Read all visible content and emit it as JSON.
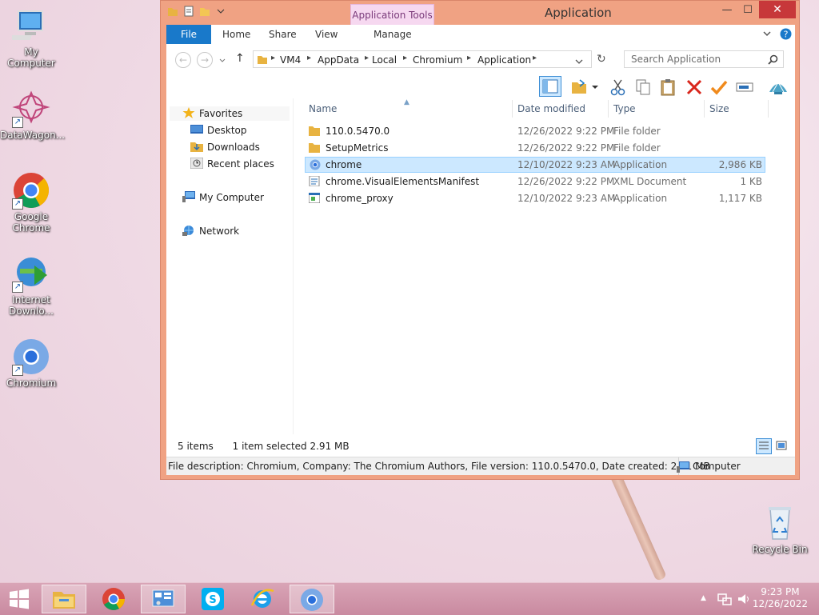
{
  "desktop": {
    "icons": [
      {
        "label": "My Computer"
      },
      {
        "label": "DataWagon..."
      },
      {
        "label": "Google Chrome"
      },
      {
        "label": "Internet Downlo..."
      },
      {
        "label": "Chromium"
      },
      {
        "label": "Recycle Bin"
      }
    ]
  },
  "window": {
    "title": "Application",
    "contextual_tab": "Application Tools",
    "controls": {
      "minimize": "—",
      "maximize": "☐",
      "close": "✕"
    },
    "ribbon": {
      "tabs": [
        {
          "label": "File"
        },
        {
          "label": "Home"
        },
        {
          "label": "Share"
        },
        {
          "label": "View"
        },
        {
          "label": "Manage"
        }
      ]
    },
    "address": {
      "crumbs": [
        "VM4",
        "AppData",
        "Local",
        "Chromium",
        "Application"
      ],
      "search_placeholder": "Search Application"
    },
    "nav": {
      "items": [
        {
          "label": "Favorites",
          "icon": "star-icon"
        },
        {
          "label": "Desktop",
          "icon": "desktop-icon"
        },
        {
          "label": "Downloads",
          "icon": "downloads-icon"
        },
        {
          "label": "Recent places",
          "icon": "recent-places-icon"
        },
        {
          "label": "My Computer",
          "icon": "computer-icon"
        },
        {
          "label": "Network",
          "icon": "network-icon"
        }
      ]
    },
    "columns": {
      "name": "Name",
      "date": "Date modified",
      "type": "Type",
      "size": "Size"
    },
    "files": [
      {
        "name": "110.0.5470.0",
        "date": "12/26/2022 9:22 PM",
        "type": "File folder",
        "size": "",
        "icon": "folder-icon"
      },
      {
        "name": "SetupMetrics",
        "date": "12/26/2022 9:22 PM",
        "type": "File folder",
        "size": "",
        "icon": "folder-icon"
      },
      {
        "name": "chrome",
        "date": "12/10/2022 9:23 AM",
        "type": "Application",
        "size": "2,986 KB",
        "icon": "chromium-icon"
      },
      {
        "name": "chrome.VisualElementsManifest",
        "date": "12/26/2022 9:22 PM",
        "type": "XML Document",
        "size": "1 KB",
        "icon": "xml-file-icon"
      },
      {
        "name": "chrome_proxy",
        "date": "12/10/2022 9:23 AM",
        "type": "Application",
        "size": "1,117 KB",
        "icon": "app-file-icon"
      }
    ],
    "status": {
      "items": "5 items",
      "selected": "1 item selected  2.91 MB"
    },
    "details_bar": {
      "description": "File description: Chromium, Company: The Chromium Authors, File version: 110.0.5470.0, Date created: 2.91 MB",
      "location": "Computer"
    }
  },
  "taskbar": {
    "time": "9:23 PM",
    "date": "12/26/2022"
  },
  "colors": {
    "accent": "#1979ca",
    "window_border": "#f0a283",
    "close": "#c7383a",
    "selection": "#cce8ff"
  }
}
